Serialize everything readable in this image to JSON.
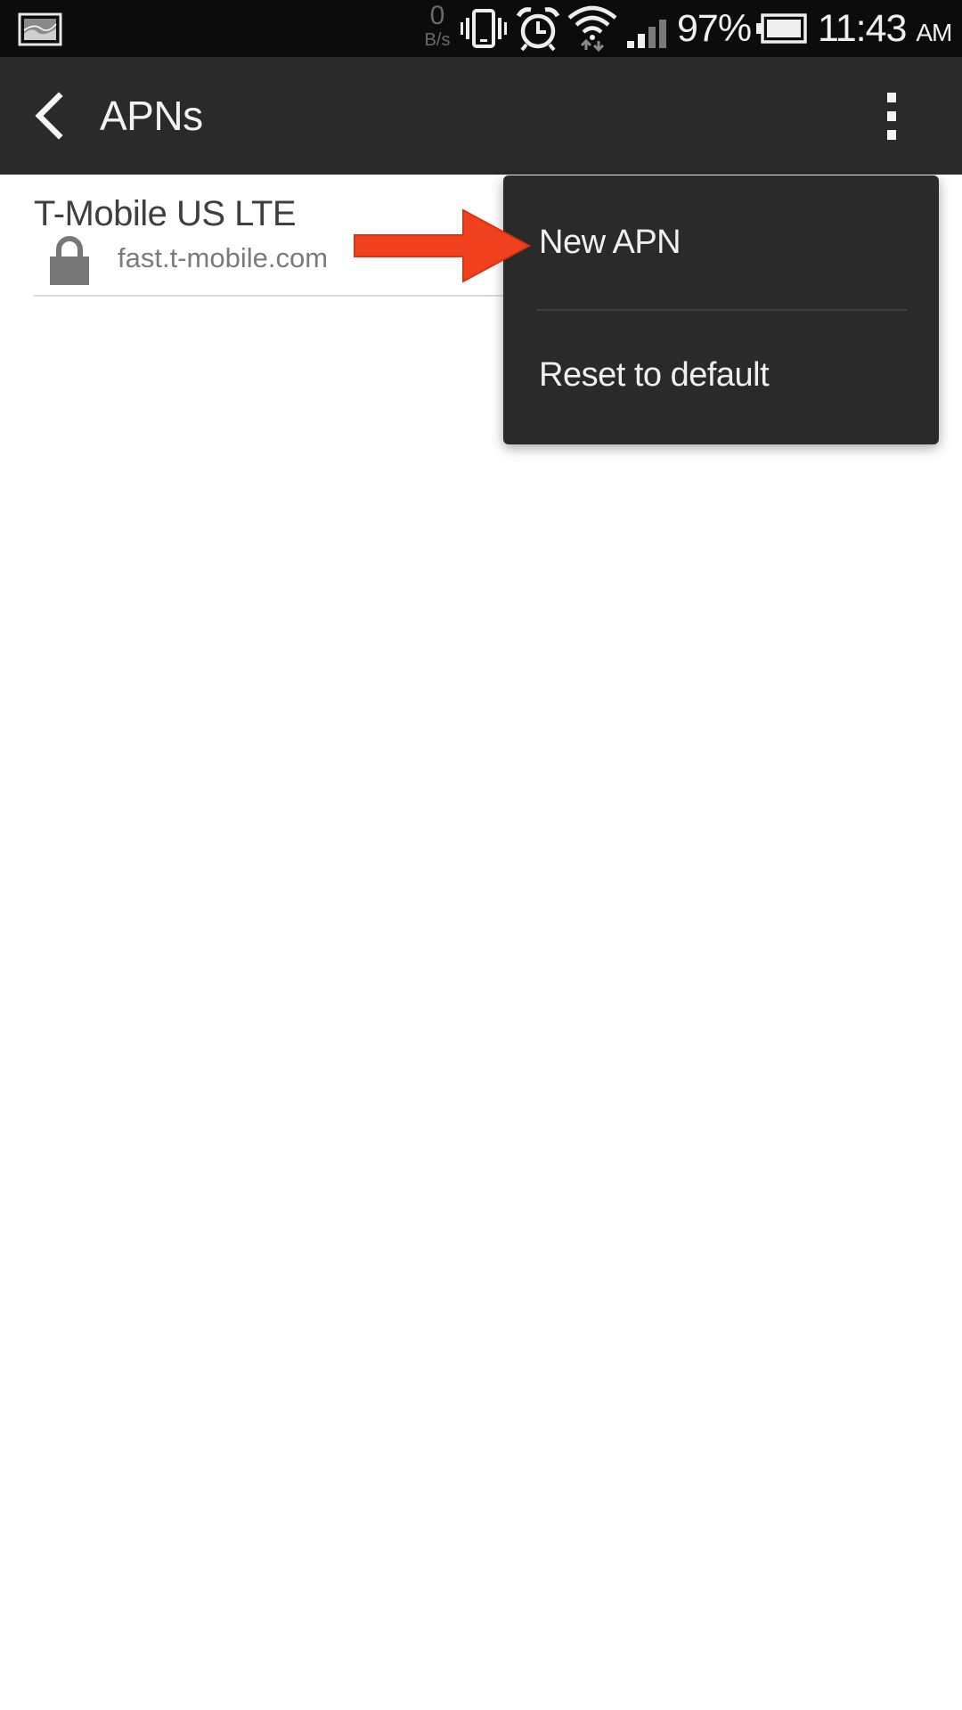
{
  "status_bar": {
    "notification_icon": "gallery-icon",
    "net_speed_value": "0",
    "net_speed_unit": "B/s",
    "battery_percent": "97%",
    "time": "11:43",
    "ampm": "AM"
  },
  "action_bar": {
    "title": "APNs",
    "back_icon": "chevron-left-icon",
    "overflow_icon": "more-vertical-icon"
  },
  "apn_list": [
    {
      "name": "T-Mobile US LTE",
      "apn": "fast.t-mobile.com",
      "locked": true
    }
  ],
  "menu": {
    "items": [
      {
        "label": "New APN"
      },
      {
        "label": "Reset to default"
      }
    ]
  },
  "colors": {
    "status_bar_bg": "#0c0c0c",
    "action_bar_bg": "#2a2a2a",
    "menu_bg": "#2a2a2a",
    "arrow": "#f1401d",
    "list_bg": "#ffffff"
  }
}
